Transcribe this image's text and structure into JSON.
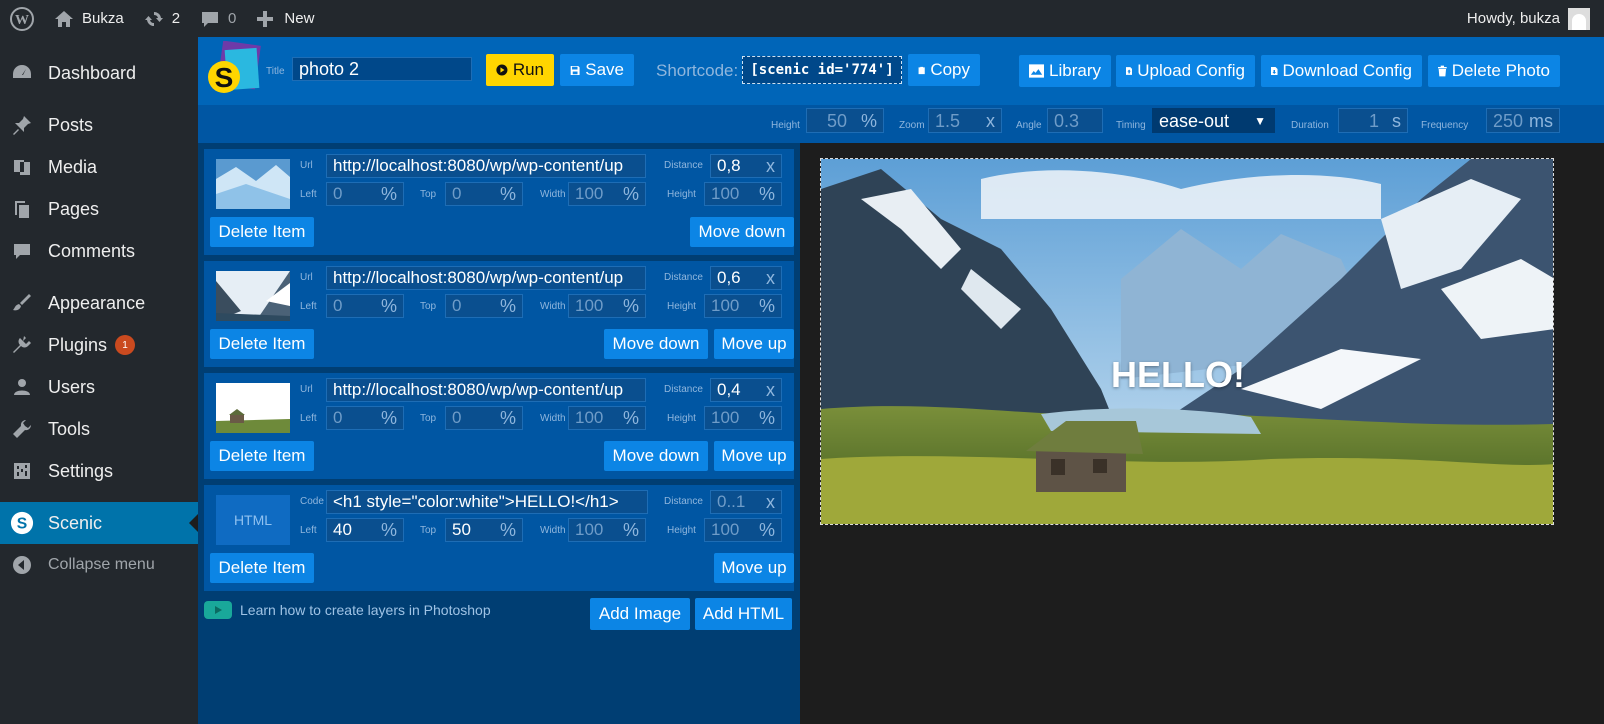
{
  "adminbar": {
    "site_name": "Bukza",
    "updates_count": "2",
    "comments_count": "0",
    "new_label": "New",
    "greeting": "Howdy, bukza"
  },
  "sidebar": {
    "items": [
      {
        "label": "Dashboard",
        "icon": "dashboard-icon"
      },
      {
        "label": "Posts",
        "icon": "pin-icon"
      },
      {
        "label": "Media",
        "icon": "media-icon"
      },
      {
        "label": "Pages",
        "icon": "pages-icon"
      },
      {
        "label": "Comments",
        "icon": "comment-icon"
      },
      {
        "label": "Appearance",
        "icon": "brush-icon"
      },
      {
        "label": "Plugins",
        "icon": "plug-icon",
        "badge": "1"
      },
      {
        "label": "Users",
        "icon": "user-icon"
      },
      {
        "label": "Tools",
        "icon": "wrench-icon"
      },
      {
        "label": "Settings",
        "icon": "sliders-icon"
      },
      {
        "label": "Scenic",
        "icon": "scenic-icon",
        "active": true
      },
      {
        "label": "Collapse menu",
        "icon": "collapse-icon"
      }
    ]
  },
  "toolbar": {
    "title_label": "Title",
    "title_value": "photo 2",
    "run_label": "Run",
    "save_label": "Save",
    "shortcode_label": "Shortcode:",
    "shortcode_value": "[scenic id='774']",
    "copy_label": "Copy",
    "library_label": "Library",
    "upload_label": "Upload Config",
    "download_label": "Download Config",
    "delete_label": "Delete Photo"
  },
  "settings": {
    "height": {
      "label": "Height",
      "value": "50",
      "unit": "%"
    },
    "zoom": {
      "label": "Zoom",
      "value": "1.5",
      "unit": "x"
    },
    "angle": {
      "label": "Angle",
      "value": "0.3"
    },
    "timing": {
      "label": "Timing",
      "value": "ease-out"
    },
    "duration": {
      "label": "Duration",
      "value": "1",
      "unit": "s"
    },
    "frequency": {
      "label": "Frequency",
      "value": "250",
      "unit": "ms"
    }
  },
  "field_labels": {
    "url": "Url",
    "code": "Code",
    "distance": "Distance",
    "left": "Left",
    "top": "Top",
    "width": "Width",
    "height": "Height",
    "pct": "%",
    "x": "x"
  },
  "layers": [
    {
      "url": "http://localhost:8080/wp/wp-content/up",
      "distance": "0,8",
      "left": "0",
      "top": "0",
      "width": "100",
      "height": "100",
      "delete": "Delete Item",
      "move_down": "Move down"
    },
    {
      "url": "http://localhost:8080/wp/wp-content/up",
      "distance": "0,6",
      "left": "0",
      "top": "0",
      "width": "100",
      "height": "100",
      "delete": "Delete Item",
      "move_down": "Move down",
      "move_up": "Move up"
    },
    {
      "url": "http://localhost:8080/wp/wp-content/up",
      "distance": "0,4",
      "left": "0",
      "top": "0",
      "width": "100",
      "height": "100",
      "delete": "Delete Item",
      "move_down": "Move down",
      "move_up": "Move up"
    },
    {
      "thumb_label": "HTML",
      "code": "<h1 style=\"color:white\">HELLO!</h1>",
      "distance": "0..1",
      "left": "40",
      "top": "50",
      "width": "100",
      "height": "100",
      "delete": "Delete Item",
      "move_up": "Move up"
    }
  ],
  "footer": {
    "learn_text": "Learn how to create layers in Photoshop",
    "add_image": "Add Image",
    "add_html": "Add HTML"
  },
  "preview": {
    "overlay_text": "HELLO!"
  }
}
